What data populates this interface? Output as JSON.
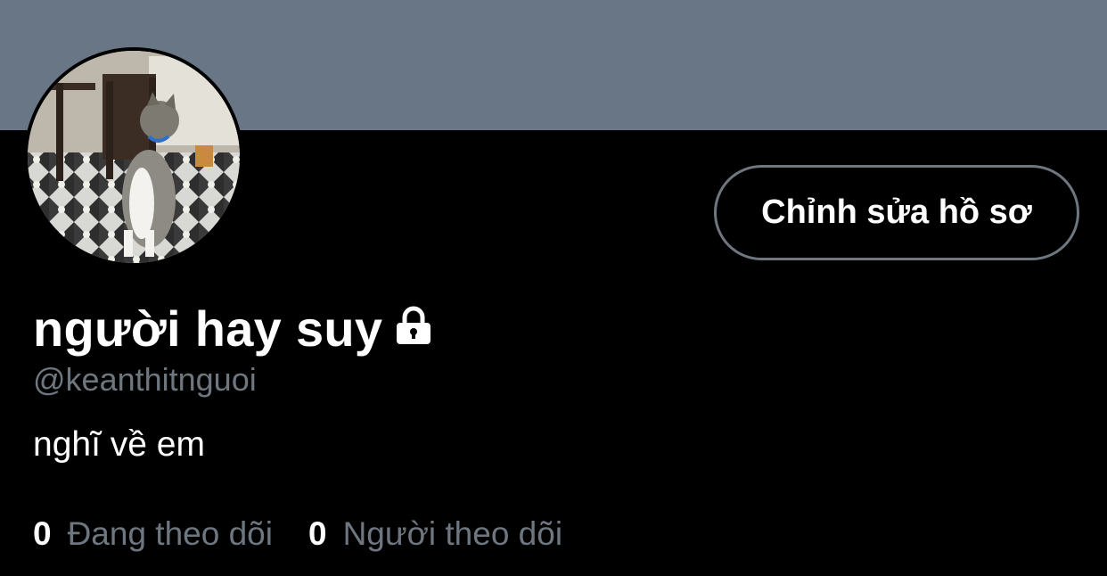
{
  "profile": {
    "display_name": "người hay suy",
    "handle": "@keanthitnguoi",
    "bio": "nghĩ về em",
    "edit_button_label": "Chỉnh sửa hồ sơ",
    "locked_icon": "lock-icon",
    "avatar_icon": "cat-photo"
  },
  "stats": {
    "following_count": "0",
    "following_label": "Đang theo dõi",
    "followers_count": "0",
    "followers_label": "Người theo dõi"
  },
  "colors": {
    "banner": "#687685",
    "background": "#000000",
    "secondary_text": "#6e7780",
    "button_border": "#6e7680"
  }
}
